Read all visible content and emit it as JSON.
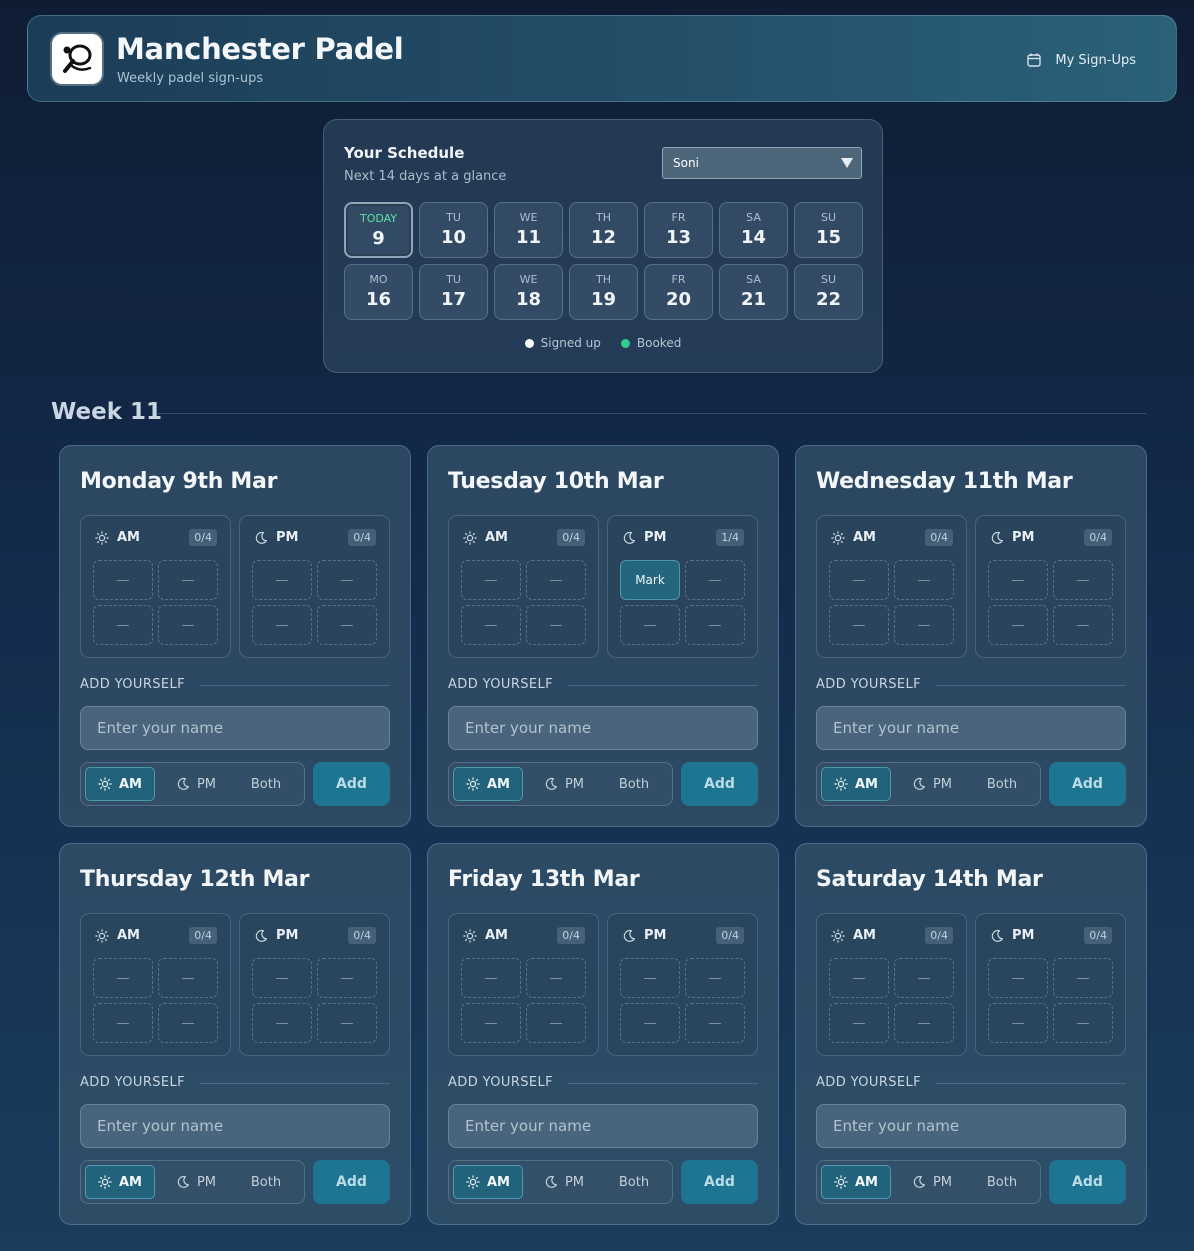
{
  "app": {
    "title": "Manchester Padel",
    "subtitle": "Weekly padel sign-ups",
    "my_signups": "My Sign-Ups"
  },
  "schedule": {
    "title": "Your Schedule",
    "subtitle": "Next 14 days at a glance",
    "selected_user": "Soni",
    "days": [
      {
        "dow": "TODAY",
        "num": "9"
      },
      {
        "dow": "TU",
        "num": "10"
      },
      {
        "dow": "WE",
        "num": "11"
      },
      {
        "dow": "TH",
        "num": "12"
      },
      {
        "dow": "FR",
        "num": "13"
      },
      {
        "dow": "SA",
        "num": "14"
      },
      {
        "dow": "SU",
        "num": "15"
      },
      {
        "dow": "MO",
        "num": "16"
      },
      {
        "dow": "TU",
        "num": "17"
      },
      {
        "dow": "WE",
        "num": "18"
      },
      {
        "dow": "TH",
        "num": "19"
      },
      {
        "dow": "FR",
        "num": "20"
      },
      {
        "dow": "SA",
        "num": "21"
      },
      {
        "dow": "SU",
        "num": "22"
      }
    ],
    "legend": {
      "signed_up": "Signed up",
      "booked": "Booked",
      "signed_color": "#ffffff",
      "booked_color": "#2ecc8f"
    }
  },
  "week": {
    "label": "Week 11"
  },
  "common": {
    "am": "AM",
    "pm": "PM",
    "both": "Both",
    "add": "Add",
    "add_yourself": "ADD YOURSELF",
    "placeholder": "Enter your name",
    "empty": "—"
  },
  "days": [
    {
      "title": "Monday 9th Mar",
      "am_count": "0/4",
      "pm_count": "0/4",
      "am_players": [],
      "pm_players": []
    },
    {
      "title": "Tuesday 10th Mar",
      "am_count": "0/4",
      "pm_count": "1/4",
      "am_players": [],
      "pm_players": [
        "Mark"
      ]
    },
    {
      "title": "Wednesday 11th Mar",
      "am_count": "0/4",
      "pm_count": "0/4",
      "am_players": [],
      "pm_players": []
    },
    {
      "title": "Thursday 12th Mar",
      "am_count": "0/4",
      "pm_count": "0/4",
      "am_players": [],
      "pm_players": []
    },
    {
      "title": "Friday 13th Mar",
      "am_count": "0/4",
      "pm_count": "0/4",
      "am_players": [],
      "pm_players": []
    },
    {
      "title": "Saturday 14th Mar",
      "am_count": "0/4",
      "pm_count": "0/4",
      "am_players": [],
      "pm_players": []
    }
  ],
  "colors": {
    "accent": "#1e7591",
    "active_segment": "#22627a"
  }
}
